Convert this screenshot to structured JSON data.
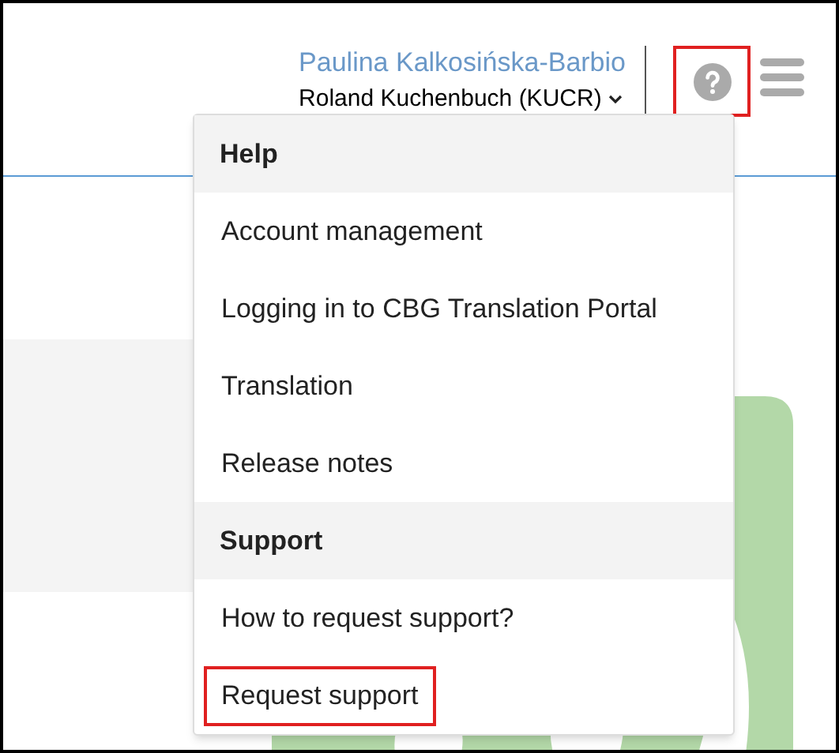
{
  "header": {
    "user_name": "Paulina Kalkosińska-Barbio",
    "account": "Roland Kuchenbuch (KUCR)",
    "help_button": {
      "highlighted": true
    }
  },
  "help_menu": {
    "sections": [
      {
        "title": "Help",
        "items": [
          {
            "label": "Account management",
            "highlighted": false
          },
          {
            "label": "Logging in to CBG Translation Portal",
            "highlighted": false
          },
          {
            "label": "Translation",
            "highlighted": false
          },
          {
            "label": "Release notes",
            "highlighted": false
          }
        ]
      },
      {
        "title": "Support",
        "items": [
          {
            "label": "How to request support?",
            "highlighted": false
          },
          {
            "label": "Request support",
            "highlighted": true
          }
        ]
      }
    ]
  }
}
